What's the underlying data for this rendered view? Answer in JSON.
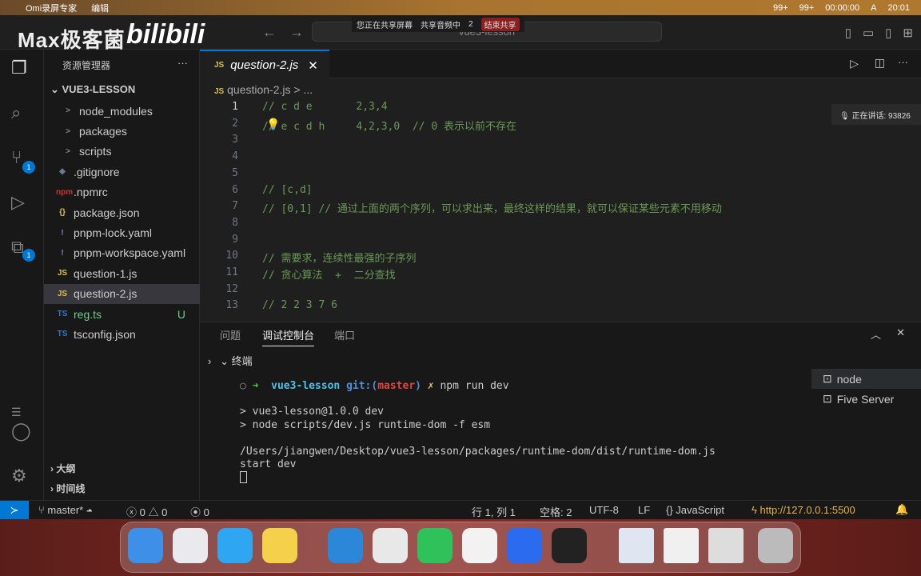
{
  "menubar": {
    "app": "Omi录屏专家",
    "menu": "编辑",
    "qq": "99+",
    "wechat": "99+",
    "timer": "00:00:00",
    "input": "A",
    "time": "20:01"
  },
  "share": {
    "sharing": "您正在共享屏幕",
    "audio": "共享音频中",
    "count": "2",
    "end": "结束共享"
  },
  "watermark": {
    "text": "Max极客菌",
    "logo": "bilibili"
  },
  "title": {
    "search": "vue3-lesson"
  },
  "speaking": "正在讲话: 93826",
  "sidebar": {
    "header": "资源管理器",
    "more": "···",
    "root": "VUE3-LESSON",
    "items": [
      {
        "icon": ">",
        "label": "node_modules",
        "color": "#888"
      },
      {
        "icon": ">",
        "label": "packages",
        "color": "#888"
      },
      {
        "icon": ">",
        "label": "scripts",
        "color": "#888"
      },
      {
        "icon": "◆",
        "label": ".gitignore",
        "color": "#6b7a8f"
      },
      {
        "icon": "npm",
        "label": ".npmrc",
        "color": "#c33"
      },
      {
        "icon": "{}",
        "label": "package.json",
        "color": "#d8c04a"
      },
      {
        "icon": "!",
        "label": "pnpm-lock.yaml",
        "color": "#a074c4"
      },
      {
        "icon": "!",
        "label": "pnpm-workspace.yaml",
        "color": "#a074c4"
      },
      {
        "icon": "JS",
        "label": "question-1.js",
        "color": "#d8c04a"
      },
      {
        "icon": "JS",
        "label": "question-2.js",
        "color": "#d8c04a"
      },
      {
        "icon": "TS",
        "label": "reg.ts",
        "color": "#3178c6",
        "badge": "U"
      },
      {
        "icon": "TS",
        "label": "tsconfig.json",
        "color": "#3178c6"
      }
    ],
    "outline": "大纲",
    "timeline": "时间线"
  },
  "activity": {
    "scm_badge": "1",
    "ext_badge": "1"
  },
  "editor": {
    "tab": "question-2.js",
    "tab_icon": "JS",
    "breadcrumb": "question-2.js > ...",
    "lines": [
      "// c d e       2,3,4",
      "// e c d h     4,2,3,0  // 0 表示以前不存在",
      "",
      "",
      "",
      "// [c,d]",
      "// [0,1] // 通过上面的两个序列，可以求出来，最终这样的结果，就可以保证某些元素不用移动",
      "",
      "",
      "// 需要求，连续性最强的子序列",
      "// 贪心算法  +  二分查找",
      "",
      "// 2 2 3 7 6"
    ]
  },
  "panel": {
    "tabs": [
      "问题",
      "调试控制台",
      "端口"
    ],
    "section": "终端",
    "prompt_dir": "vue3-lesson",
    "prompt_git": "git:(",
    "prompt_branch": "master",
    "prompt_end": ")",
    "prompt_x": "✗",
    "command": "npm run dev",
    "output": [
      "> vue3-lesson@1.0.0 dev",
      "> node scripts/dev.js runtime-dom -f esm",
      "",
      "/Users/jiangwen/Desktop/vue3-lesson/packages/runtime-dom/dist/runtime-dom.js",
      "start dev"
    ],
    "terminals": [
      "node",
      "Five Server"
    ]
  },
  "status": {
    "branch": "master*",
    "errors": "0",
    "warnings": "0",
    "ports": "0",
    "position": "行 1, 列 1",
    "spaces": "空格: 2",
    "encoding": "UTF-8",
    "eol": "LF",
    "language": "JavaScript",
    "server": "http://127.0.0.1:5500"
  }
}
